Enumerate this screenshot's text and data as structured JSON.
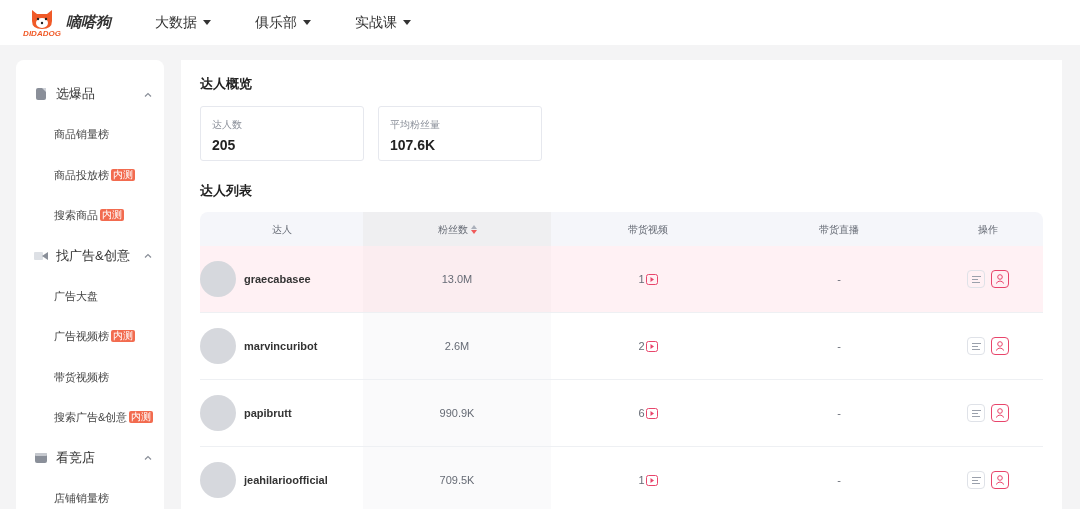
{
  "brand": {
    "name": "嘀嗒狗",
    "logo_text": "DIDADOG"
  },
  "nav": [
    {
      "label": "大数据"
    },
    {
      "label": "俱乐部"
    },
    {
      "label": "实战课"
    }
  ],
  "sidebar": {
    "groups": [
      {
        "title": "选爆品",
        "expanded": true,
        "items": [
          {
            "label": "商品销量榜"
          },
          {
            "label": "商品投放榜",
            "badge": "内测"
          },
          {
            "label": "搜索商品",
            "badge": "内测"
          }
        ]
      },
      {
        "title": "找广告&创意",
        "expanded": true,
        "items": [
          {
            "label": "广告大盘"
          },
          {
            "label": "广告视频榜",
            "badge": "内测"
          },
          {
            "label": "带货视频榜"
          },
          {
            "label": "搜索广告&创意",
            "badge": "内测"
          }
        ]
      },
      {
        "title": "看竞店",
        "expanded": true,
        "items": [
          {
            "label": "店铺销量榜"
          }
        ]
      }
    ]
  },
  "overview": {
    "title": "达人概览",
    "stats": [
      {
        "label": "达人数",
        "value": "205"
      },
      {
        "label": "平均粉丝量",
        "value": "107.6K"
      }
    ]
  },
  "list": {
    "title": "达人列表",
    "columns": [
      {
        "label": "达人",
        "sortable": false
      },
      {
        "label": "粉丝数",
        "sortable": true
      },
      {
        "label": "带货视频",
        "sortable": false
      },
      {
        "label": "带货直播",
        "sortable": false
      },
      {
        "label": "操作",
        "sortable": false
      }
    ],
    "rows": [
      {
        "name": "graecabasee",
        "followers": "13.0M",
        "videos": "1",
        "live": "-",
        "highlighted": true
      },
      {
        "name": "marvincuribot",
        "followers": "2.6M",
        "videos": "2",
        "live": "-",
        "highlighted": false
      },
      {
        "name": "papibrutt",
        "followers": "990.9K",
        "videos": "6",
        "live": "-",
        "highlighted": false
      },
      {
        "name": "jeahilarioofficial",
        "followers": "709.5K",
        "videos": "1",
        "live": "-",
        "highlighted": false
      }
    ]
  }
}
